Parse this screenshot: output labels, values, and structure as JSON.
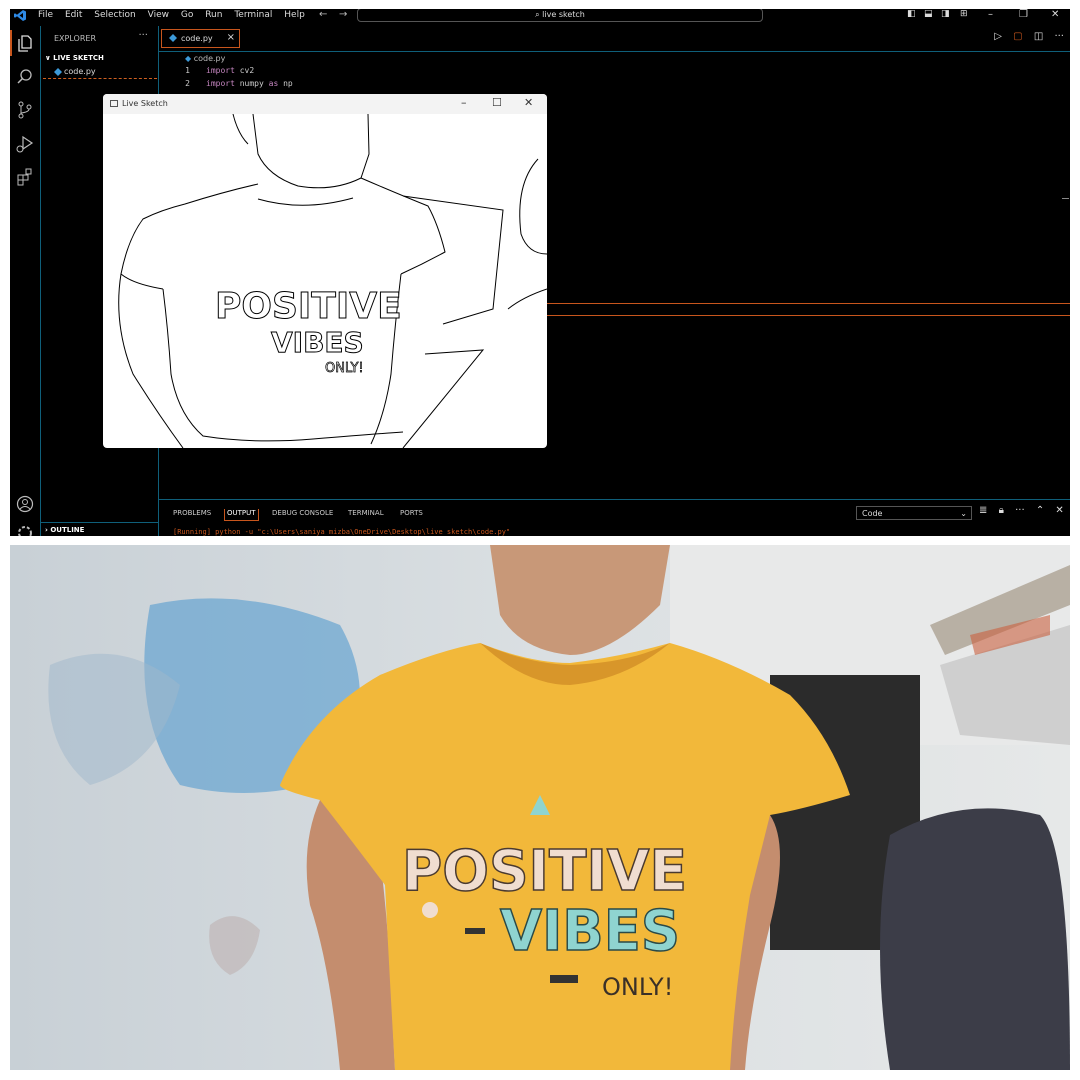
{
  "titlebar": {
    "menu": [
      "File",
      "Edit",
      "Selection",
      "View",
      "Go",
      "Run",
      "Terminal",
      "Help"
    ],
    "search_text": "live sketch"
  },
  "sidebar": {
    "title": "EXPLORER",
    "folder": "LIVE SKETCH",
    "file": "code.py",
    "outline": "OUTLINE"
  },
  "editor": {
    "tab_label": "code.py",
    "breadcrumb": "code.py",
    "lines": [
      {
        "num": "1",
        "kw": "import",
        "rest": " cv2"
      },
      {
        "num": "2",
        "kw": "import",
        "rest": " numpy ",
        "kw2": "as",
        "rest2": " np"
      }
    ]
  },
  "sketch_window": {
    "title": "Live Sketch",
    "shirt_text_1": "POSITIVE",
    "shirt_text_2": "VIBES",
    "shirt_text_3": "ONLY!"
  },
  "panel": {
    "tabs": [
      "PROBLEMS",
      "OUTPUT",
      "DEBUG CONSOLE",
      "TERMINAL",
      "PORTS"
    ],
    "active_tab": "OUTPUT",
    "select_value": "Code",
    "run_line": "[Running] python -u \"c:\\Users\\saniya mizba\\OneDrive\\Desktop\\live sketch\\code.py\""
  },
  "camera": {
    "shirt_text_1": "POSITIVE",
    "shirt_text_2": "VIBES",
    "shirt_text_3": "ONLY!"
  },
  "colors": {
    "accent": "#c8561d",
    "border": "#0f5f7a",
    "shirt": "#f2b83a"
  }
}
